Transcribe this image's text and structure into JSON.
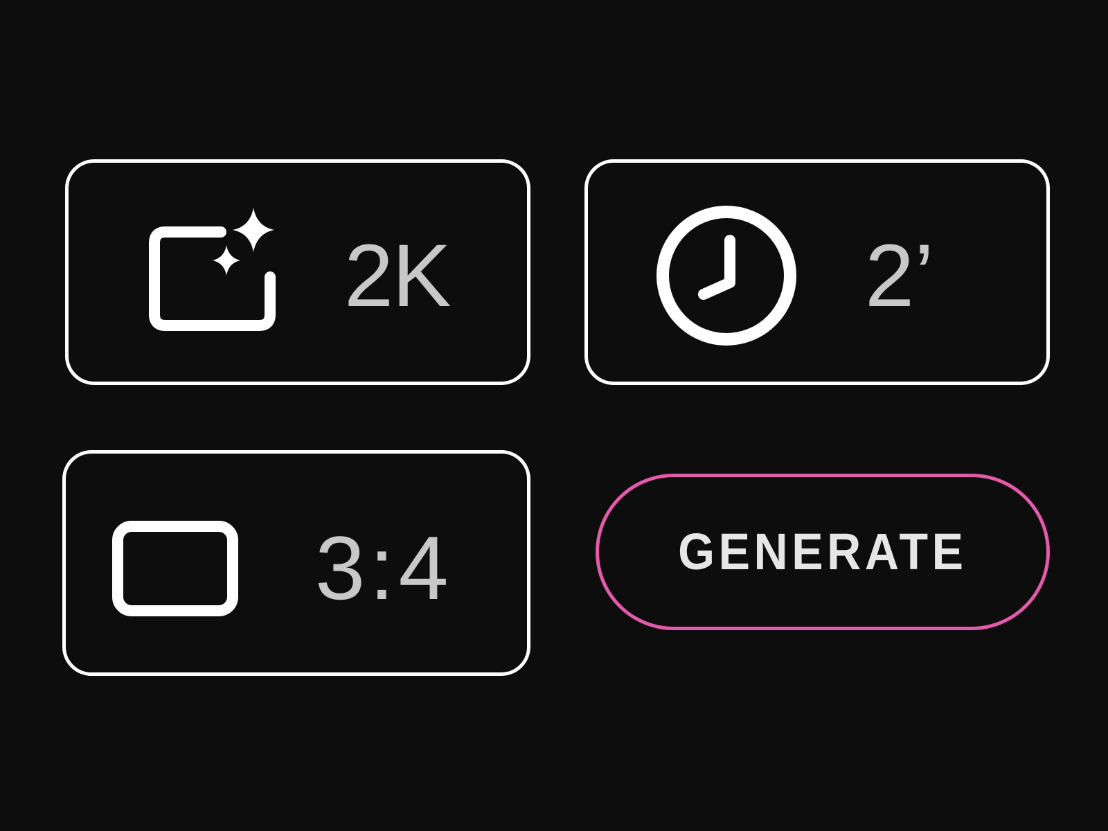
{
  "controls": {
    "resolution": {
      "value": "2K",
      "icon": "image-sparkle-icon"
    },
    "duration": {
      "value": "2’",
      "icon": "clock-icon"
    },
    "aspect_ratio": {
      "value": "3:4",
      "icon": "frame-icon"
    }
  },
  "generate": {
    "label": "GENERATE"
  },
  "colors": {
    "background": "#0d0d0d",
    "border": "#ffffff",
    "value_text": "#c8c8c8",
    "accent": "#e25aa8"
  }
}
